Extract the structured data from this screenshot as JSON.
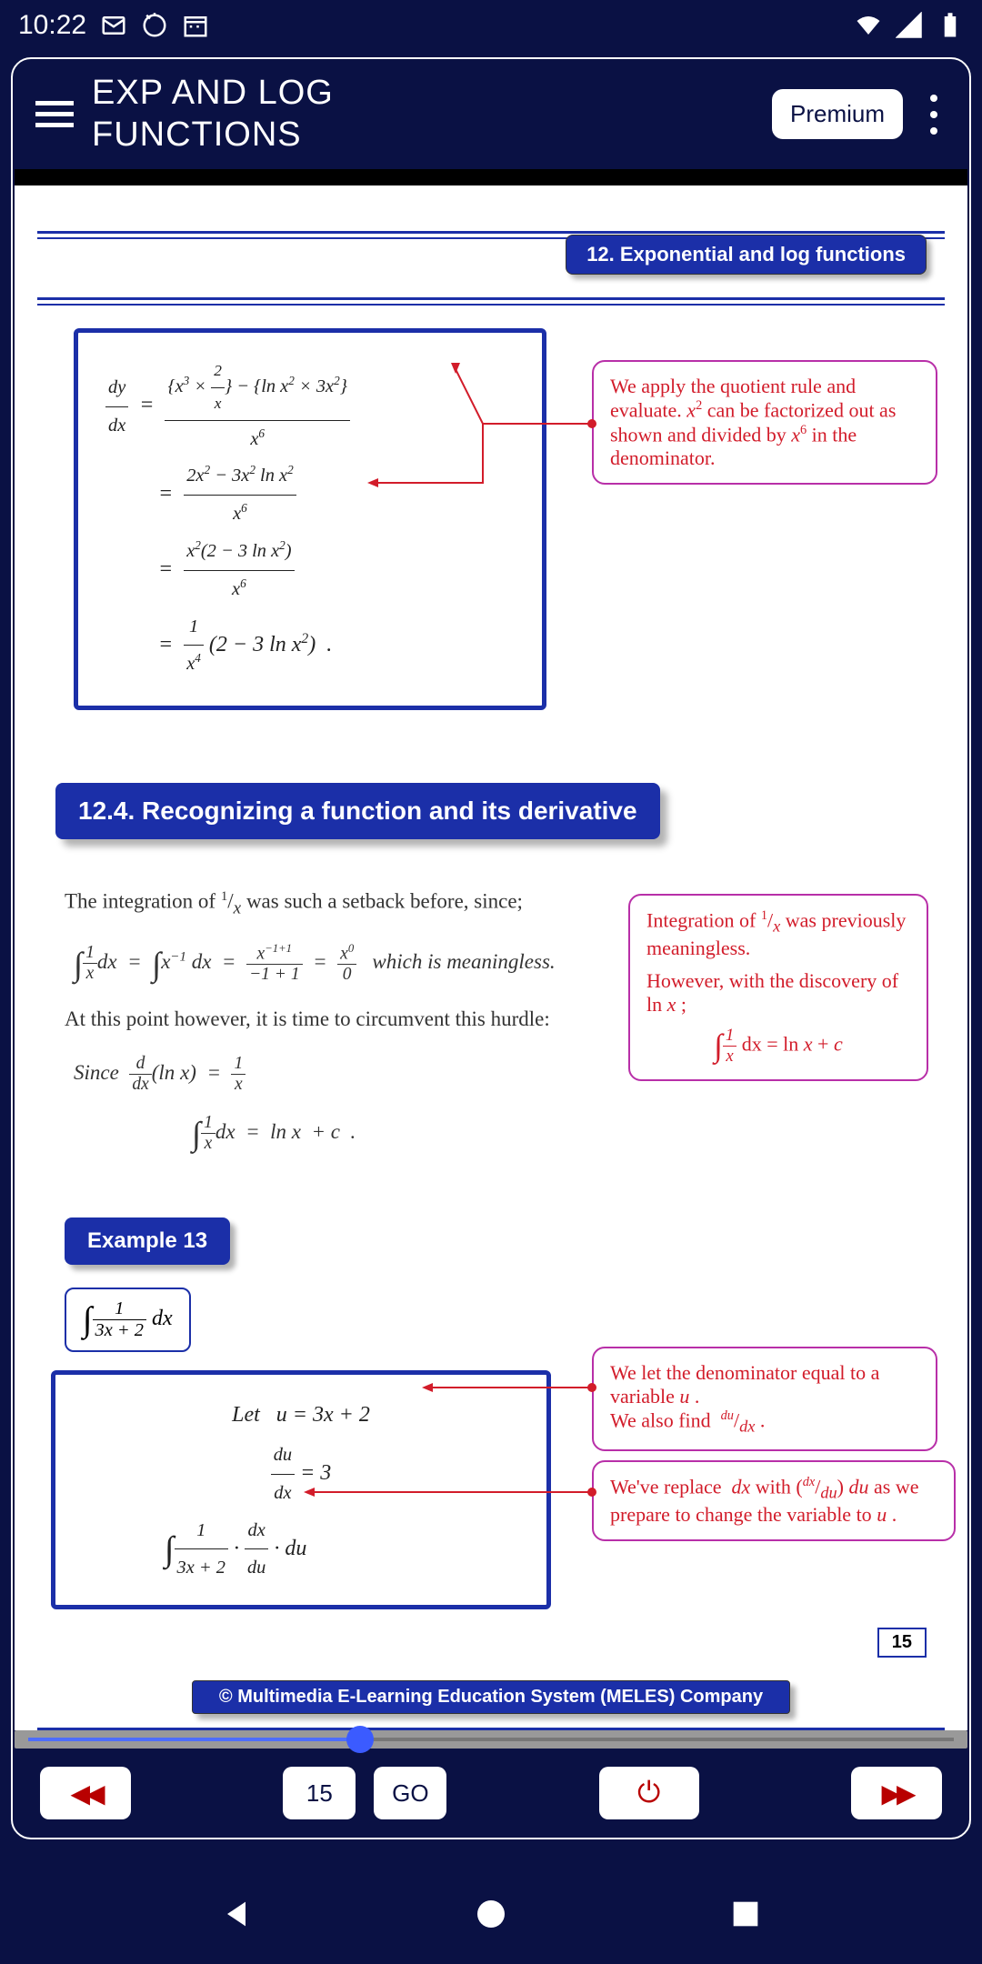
{
  "status": {
    "time": "10:22"
  },
  "header": {
    "title_line1": "EXP AND LOG",
    "title_line2": "FUNCTIONS",
    "premium_label": "Premium"
  },
  "chapter_tag": "12. Exponential and log functions",
  "derivation": {
    "line1_lhs": "dy/dx",
    "line1_rhs_num": "{x³ × 2/x} − {ln x² × 3x²}",
    "line1_rhs_den": "x⁶",
    "line2_num": "2x² − 3x² ln x²",
    "line2_den": "x⁶",
    "line3_num": "x²(2 − 3 ln x²)",
    "line3_den": "x⁶",
    "line4": "= 1/x⁴ (2 − 3 ln x²) ."
  },
  "annotation1": "We apply the quotient rule and evaluate. x² can be factorized out as shown and divided by x⁶ in the denominator.",
  "section_header": "12.4. Recognizing a function and its derivative",
  "text1_a": "The integration of ",
  "text1_b": " was such a setback before, since;",
  "integral_line": "∫ 1/x dx  =  ∫ x⁻¹ dx  =  x⁻¹⁺¹ / (−1 + 1)  =  x⁰ / 0   which is meaningless.",
  "text2": "At this point however, it is time to circumvent this hurdle:",
  "since_line": "Since  d/dx (ln x)  =  1/x",
  "integral_result": "∫ 1/x dx  =  ln x  + c .",
  "annotation2_a": "Integration of ¹/ₓ was previously meaningless.",
  "annotation2_b": "However, with the discovery of ln x ;",
  "annotation2_c": "∫ 1/x dx = ln x + c",
  "example_label": "Example 13",
  "problem": "∫ 1/(3x + 2) dx",
  "let_line": "Let   u = 3x + 2",
  "du_line": "du/dx = 3",
  "sub_line": "∫ 1/(3x + 2) · dx/du · du",
  "annotation3_a": "We let the denominator equal to a variable u .",
  "annotation3_b": "We also find  du/dx .",
  "annotation4_a": "We've replace  dx with (dx/du) du as we prepare to change the variable to u .",
  "page_num": "15",
  "copyright": "© Multimedia E-Learning Education System (MELES) Company",
  "nav": {
    "page": "15",
    "go": "GO"
  }
}
